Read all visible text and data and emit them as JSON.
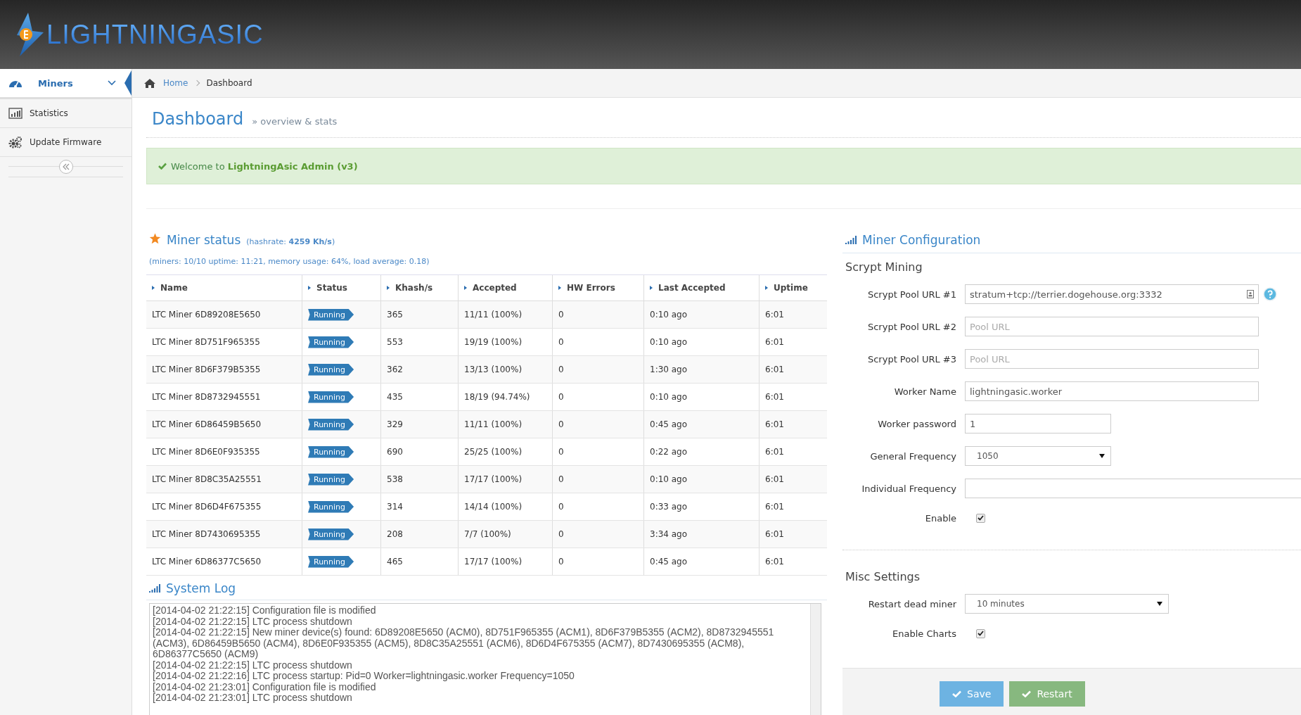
{
  "logo": {
    "text": "LIGHTNINGASIC"
  },
  "sidebar": {
    "items": [
      {
        "label": "Miners",
        "selected": true
      },
      {
        "label": "Statistics",
        "selected": false
      },
      {
        "label": "Update Firmware",
        "selected": false
      }
    ]
  },
  "breadcrumb": [
    "Home",
    "Dashboard"
  ],
  "page_title": "Dashboard",
  "page_subtitle": "» overview & stats",
  "alert": {
    "text": "Welcome to **LightningAsic Admin (v3)**"
  },
  "miner_status": {
    "title": "Miner status",
    "hashrate": "(hashrate: **4259 Kh/s**)",
    "summary": "(miners: 10/10 uptime: 11:21, memory usage: 64%, load average: 0.18)",
    "columns": [
      "Name",
      "Status",
      "Khash/s",
      "Accepted",
      "HW Errors",
      "Last Accepted",
      "Uptime"
    ],
    "rows": [
      [
        "LTC Miner 6D89208E5650",
        "Running",
        "365",
        "11/11 (100%)",
        "0",
        "0:10 ago",
        "6:01"
      ],
      [
        "LTC Miner 8D751F965355",
        "Running",
        "553",
        "19/19 (100%)",
        "0",
        "0:10 ago",
        "6:01"
      ],
      [
        "LTC Miner 8D6F379B5355",
        "Running",
        "362",
        "13/13 (100%)",
        "0",
        "1:30 ago",
        "6:01"
      ],
      [
        "LTC Miner 8D8732945551",
        "Running",
        "435",
        "18/19 (94.74%)",
        "0",
        "0:10 ago",
        "6:01"
      ],
      [
        "LTC Miner 6D86459B5650",
        "Running",
        "329",
        "11/11 (100%)",
        "0",
        "0:45 ago",
        "6:01"
      ],
      [
        "LTC Miner 8D6E0F935355",
        "Running",
        "690",
        "25/25 (100%)",
        "0",
        "0:22 ago",
        "6:01"
      ],
      [
        "LTC Miner 8D8C35A25551",
        "Running",
        "538",
        "17/17 (100%)",
        "0",
        "0:10 ago",
        "6:01"
      ],
      [
        "LTC Miner 8D6D4F675355",
        "Running",
        "314",
        "14/14 (100%)",
        "0",
        "0:33 ago",
        "6:01"
      ],
      [
        "LTC Miner 8D7430695355",
        "Running",
        "208",
        "7/7 (100%)",
        "0",
        "3:34 ago",
        "6:01"
      ],
      [
        "LTC Miner 6D86377C5650",
        "Running",
        "465",
        "17/17 (100%)",
        "0",
        "0:45 ago",
        "6:01"
      ]
    ]
  },
  "system_log": {
    "title": "System Log",
    "lines": [
      "[2014-04-02 21:22:15] Configuration file is modified",
      "[2014-04-02 21:22:15] LTC process shutdown",
      "[2014-04-02 21:22:15] New miner device(s) found: 6D89208E5650 (ACM0), 8D751F965355 (ACM1), 8D6F379B5355 (ACM2), 8D8732945551 (ACM3), 6D86459B5650 (ACM4), 8D6E0F935355 (ACM5), 8D8C35A25551 (ACM6), 8D6D4F675355 (ACM7), 8D7430695355 (ACM8), 6D86377C5650 (ACM9)",
      "[2014-04-02 21:22:15] LTC process shutdown",
      "[2014-04-02 21:22:16] LTC process startup: Pid=0 Worker=lightningasic.worker Frequency=1050",
      "[2014-04-02 21:23:01] Configuration file is modified",
      "[2014-04-02 21:23:01] LTC process shutdown"
    ]
  },
  "miner_configuration": {
    "title": "Miner Configuration",
    "sections": [
      {
        "title": "Scrypt Mining",
        "fields": [
          {
            "kind": "text",
            "label": "Scrypt Pool URL #1",
            "value": "stratum+tcp://terrier.dogehouse.org:3332",
            "help": true
          },
          {
            "kind": "text",
            "label": "Scrypt Pool URL #2",
            "placeholder": "Pool URL"
          },
          {
            "kind": "text",
            "label": "Scrypt Pool URL #3",
            "placeholder": "Pool URL"
          },
          {
            "kind": "text",
            "label": "Worker Name",
            "value": "lightningasic.worker"
          },
          {
            "kind": "text",
            "label": "Worker password",
            "value": "1"
          },
          {
            "kind": "select",
            "label": "General Frequency",
            "value": "1050"
          },
          {
            "kind": "text",
            "label": "Individual Frequency"
          },
          {
            "kind": "checkbox",
            "label": "Enable",
            "checked": true
          }
        ]
      },
      {
        "title": "Misc Settings",
        "fields": [
          {
            "kind": "select",
            "label": "Restart dead miner",
            "value": "10 minutes"
          },
          {
            "kind": "checkbox",
            "label": "Enable Charts",
            "checked": true
          }
        ]
      }
    ]
  },
  "buttons": [
    {
      "label": "Save",
      "kind": "primary"
    },
    {
      "label": "Restart",
      "kind": "success"
    }
  ]
}
